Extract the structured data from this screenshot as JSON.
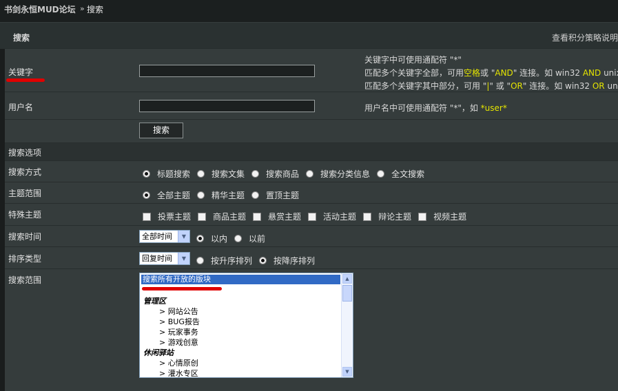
{
  "breadcrumb": {
    "site": "书剑永恒MUD论坛",
    "separator": "»",
    "current": "搜索"
  },
  "panel": {
    "title": "搜索",
    "right_link": "查看积分策略说明"
  },
  "keyword": {
    "label": "关键字",
    "value": "",
    "hint_line1": "关键字中可使用通配符 \"*\"",
    "hint_line2": {
      "a": "匹配多个关键字全部，可用",
      "b": "空格",
      "c": "或 \"",
      "d": "AND",
      "e": "\" 连接。如 win32 ",
      "f": "AND",
      "g": " unix"
    },
    "hint_line3": {
      "a": "匹配多个关键字其中部分，可用 \"",
      "b": "|",
      "c": "\" 或 \"",
      "d": "OR",
      "e": "\" 连接。如 win32 ",
      "f": "OR",
      "g": " unix"
    }
  },
  "username": {
    "label": "用户名",
    "value": "",
    "hint_a": "用户名中可使用通配符 \"*\"，如 ",
    "hint_b": "*user*"
  },
  "search_button": "搜索",
  "options_header": "搜索选项",
  "search_mode": {
    "label": "搜索方式",
    "options": [
      "标题搜索",
      "搜索文集",
      "搜索商品",
      "搜索分类信息",
      "全文搜索"
    ],
    "selected": "标题搜索"
  },
  "topic_scope": {
    "label": "主题范围",
    "options": [
      "全部主题",
      "精华主题",
      "置顶主题"
    ],
    "selected": "全部主题"
  },
  "special_topics": {
    "label": "特殊主题",
    "options": [
      "投票主题",
      "商品主题",
      "悬赏主题",
      "活动主题",
      "辩论主题",
      "视频主题"
    ]
  },
  "search_time": {
    "label": "搜索时间",
    "select_value": "全部时间",
    "options": [
      "以内",
      "以前"
    ],
    "selected": "以内"
  },
  "sort_type": {
    "label": "排序类型",
    "select_value": "回复时间",
    "options": [
      "按升序排列",
      "按降序排列"
    ],
    "selected": "按降序排列"
  },
  "search_range": {
    "label": "搜索范围",
    "selected_item": "搜索所有开放的版块",
    "groups": [
      {
        "name": "管理区",
        "items": [
          "网站公告",
          "BUG报告",
          "玩家事务",
          "游戏创意"
        ]
      },
      {
        "name": "休闲驿站",
        "items": [
          "心情原创",
          "灌水专区"
        ]
      }
    ],
    "item_prefix": ">"
  },
  "colors": {
    "highlight": "#e4e400",
    "selection": "#316ac5",
    "annotation": "#e00000"
  },
  "icons": [
    "chevron-down-icon",
    "scroll-up-icon",
    "scroll-down-icon"
  ]
}
